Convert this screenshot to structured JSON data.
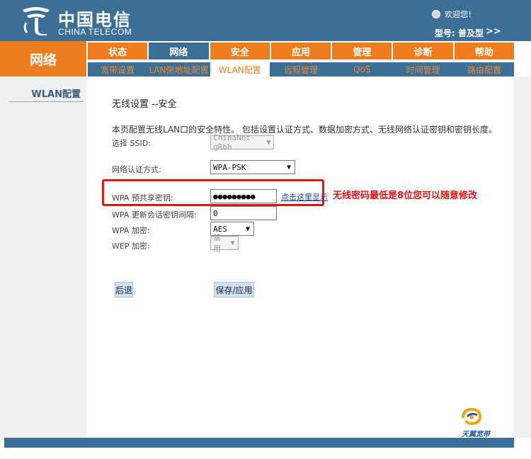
{
  "brand": {
    "name_cn": "中国电信",
    "name_en": "CHINA TELECOM"
  },
  "header": {
    "welcome": "欢迎您！",
    "model": "型号: 普及型",
    "model_arrow": ">>"
  },
  "section": {
    "label": "网络"
  },
  "main_tabs": [
    {
      "label": "状态",
      "active": false
    },
    {
      "label": "网络",
      "active": true
    },
    {
      "label": "安全",
      "active": false
    },
    {
      "label": "应用",
      "active": false
    },
    {
      "label": "管理",
      "active": false
    },
    {
      "label": "诊断",
      "active": false
    },
    {
      "label": "帮助",
      "active": false
    }
  ],
  "sub_tabs": [
    {
      "label": "宽带设置",
      "active": false
    },
    {
      "label": "LAN侧地址配置",
      "active": false
    },
    {
      "label": "WLAN配置",
      "active": true
    },
    {
      "label": "远程管理",
      "active": false
    },
    {
      "label": "QoS",
      "active": false
    },
    {
      "label": "时间管理",
      "active": false
    },
    {
      "label": "路由配置",
      "active": false
    }
  ],
  "sidebar": {
    "items": [
      {
        "label": "WLAN配置"
      }
    ]
  },
  "content": {
    "title": "无线设置 --安全",
    "description": "本页配置无线LAN口的安全特性。 包括设置认证方式、数据加密方式、无线网络认证密钥和密钥长度。",
    "ssid": {
      "label": "选择 SSID:",
      "value": "ChinaNet-gRbh",
      "disabled": true
    },
    "auth": {
      "label": "网络认证方式:",
      "value": "WPA-PSK"
    },
    "psk": {
      "label": "WPA 预共享密钥:",
      "value": "●●●●●●●●●",
      "show_link": "点击这里显示"
    },
    "rekey": {
      "label": "WPA 更新会话密钥间隔:",
      "value": "0"
    },
    "wpa_enc": {
      "label": "WPA 加密:",
      "value": "AES"
    },
    "wep_enc": {
      "label": "WEP 加密:",
      "value": "禁用",
      "disabled": true
    },
    "annotation": "无线密码最低是8位您可以随意修改",
    "back_button": "后退",
    "save_button": "保存/应用"
  },
  "bottom_logo": {
    "text": "天翼宽带"
  },
  "colors": {
    "header_blue": "#3d6f96",
    "orange": "#ee7d1f",
    "annotation_red": "#e01616",
    "link_blue": "#1a3fa8"
  },
  "icons": {
    "welcome": "user-icon",
    "brand": "china-telecom-logo",
    "bottom": "tianyi-broadband-logo"
  }
}
